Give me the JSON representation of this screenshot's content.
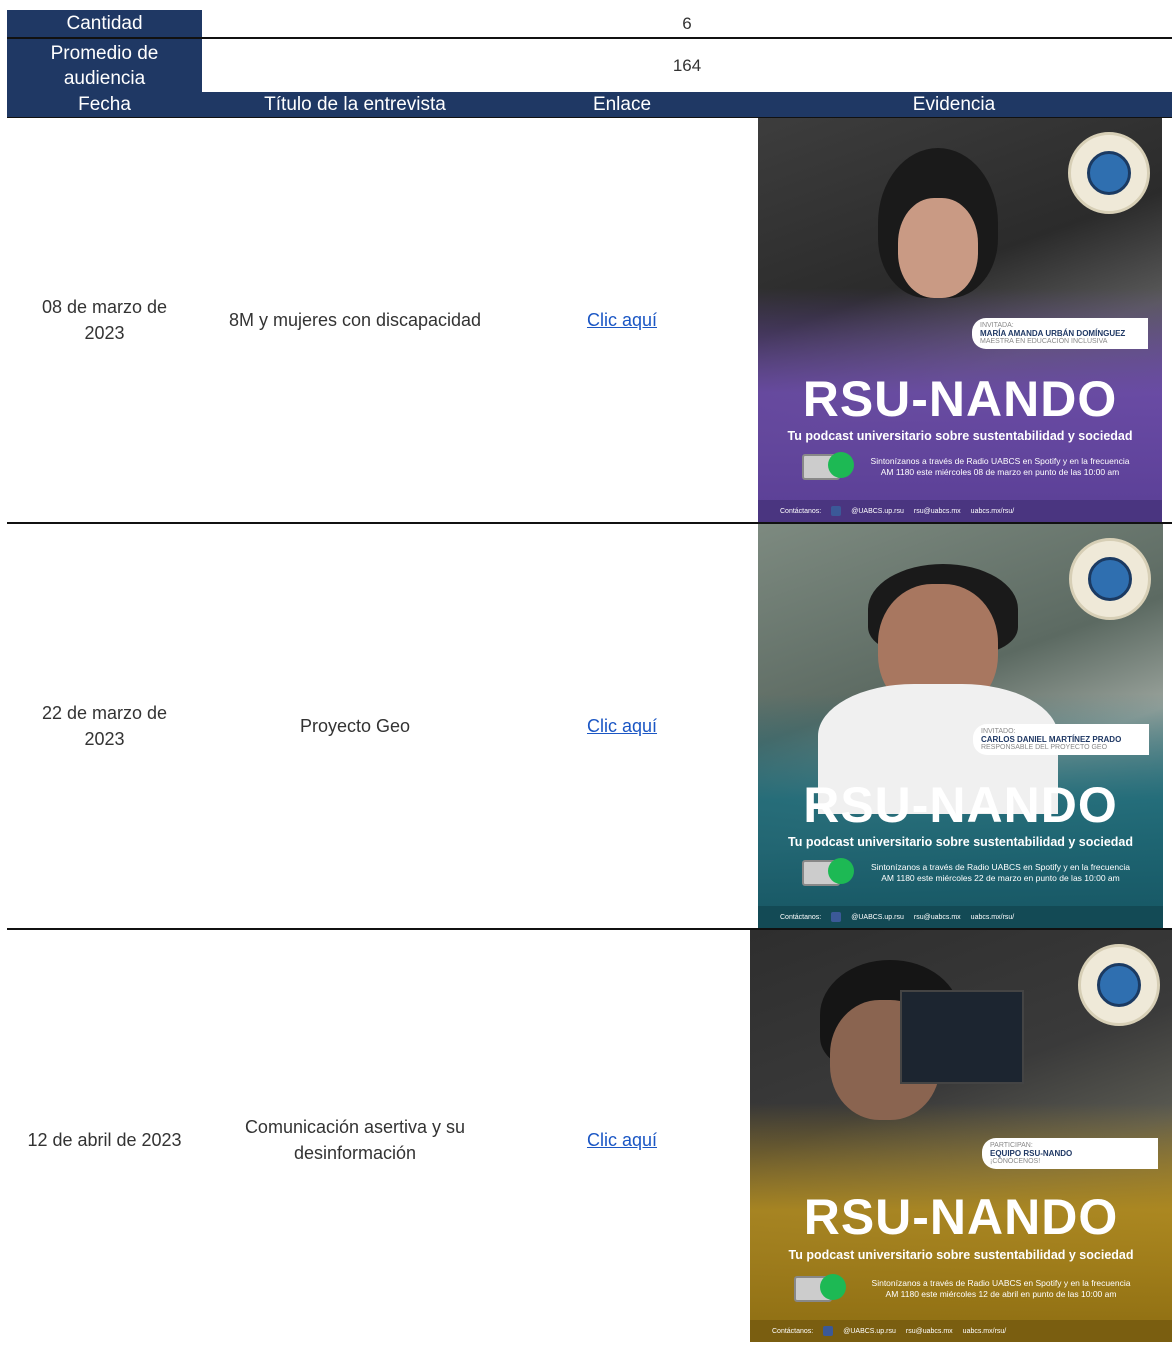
{
  "summary": {
    "quantity_label": "Cantidad",
    "quantity_value": "6",
    "audience_label_line1": "Promedio de",
    "audience_label_line2": "audiencia",
    "audience_value": "164"
  },
  "headers": {
    "date": "Fecha",
    "title": "Título de la entrevista",
    "link": "Enlace",
    "evidence": "Evidencia"
  },
  "rows": [
    {
      "date_line1": "08 de marzo de",
      "date_line2": "2023",
      "title_line1": "8M y mujeres con discapacidad",
      "title_line2": "",
      "link": "Clic aquí",
      "poster": {
        "guest_role": "INVITADA:",
        "guest_name": "MARÍA AMANDA URBÁN DOMÍNGUEZ",
        "guest_sub": "MAESTRA EN EDUCACIÓN INCLUSIVA",
        "tune_line1": "Sintonízanos a través de Radio UABCS en Spotify y en la frecuencia",
        "tune_line2": "AM 1180 este miércoles 08 de marzo en punto de las 10:00 am",
        "colors": {
          "top": "#4a4a4a",
          "bottom": "#6a4aa8"
        }
      }
    },
    {
      "date_line1": "22 de marzo de",
      "date_line2": "2023",
      "title_line1": "Proyecto Geo",
      "title_line2": "",
      "link": "Clic aquí",
      "poster": {
        "guest_role": "INVITADO:",
        "guest_name": "CARLOS DANIEL MARTÍNEZ PRADO",
        "guest_sub": "RESPONSABLE DEL PROYECTO GEO",
        "tune_line1": "Sintonízanos a través de Radio UABCS en Spotify y en la frecuencia",
        "tune_line2": "AM 1180 este miércoles 22 de marzo en punto de las 10:00 am",
        "colors": {
          "top": "#5c6a62",
          "bottom": "#1d6a78"
        }
      }
    },
    {
      "date_line1": "12 de abril de 2023",
      "date_line2": "",
      "title_line1": "Comunicación asertiva y su",
      "title_line2": "desinformación",
      "link": "Clic aquí",
      "poster": {
        "guest_role": "PARTICIPAN:",
        "guest_name": "EQUIPO RSU-NANDO",
        "guest_sub": "¡CONÓCENOS!",
        "tune_line1": "Sintonízanos a través de Radio UABCS en Spotify y en la frecuencia",
        "tune_line2": "AM 1180 este miércoles 12 de abril en punto de las 10:00 am",
        "colors": {
          "top": "#3a3a3a",
          "bottom": "#b08a1e"
        }
      }
    }
  ],
  "poster_common": {
    "brand": "RSU-NANDO",
    "tagline": "Tu podcast universitario sobre sustentabilidad y sociedad",
    "contact_label": "Contáctanos:",
    "handle": "@UABCS.up.rsu",
    "email": "rsu@uabcs.mx",
    "web": "uabcs.mx/rsu/"
  }
}
